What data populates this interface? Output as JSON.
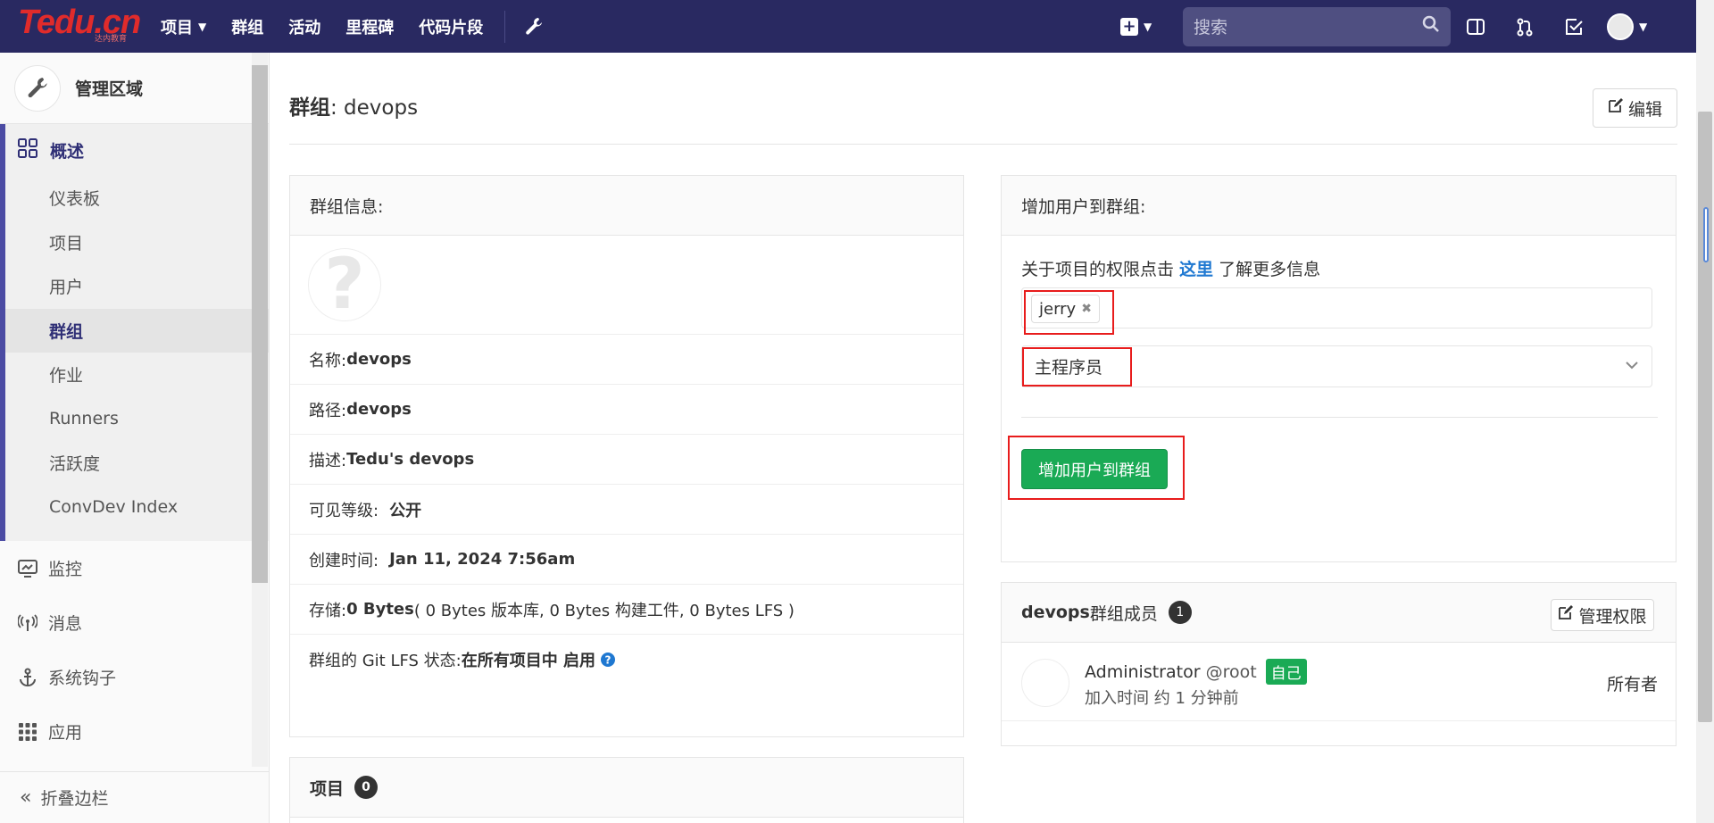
{
  "navbar": {
    "logo_text": "Tedu.cn",
    "logo_sub": "达内教育",
    "links": [
      "项目",
      "群组",
      "活动",
      "里程碑",
      "代码片段"
    ],
    "search_placeholder": "搜索"
  },
  "sidebar": {
    "title": "管理区域",
    "overview_label": "概述",
    "sub_items": [
      "仪表板",
      "项目",
      "用户",
      "群组",
      "作业",
      "Runners",
      "活跃度",
      "ConvDev Index"
    ],
    "active_sub": "群组",
    "items": [
      "监控",
      "消息",
      "系统钩子",
      "应用"
    ],
    "collapse_label": "折叠边栏"
  },
  "page": {
    "title_label": "群组",
    "title_name": ": devops",
    "edit_label": "编辑"
  },
  "group_info": {
    "header": "群组信息:",
    "name_label": "名称: ",
    "name_value": "devops",
    "path_label": "路径: ",
    "path_value": "devops",
    "desc_label": "描述: ",
    "desc_value": "Tedu's devops",
    "visibility_label": "可见等级:",
    "visibility_value": "公开",
    "created_label": "创建时间:",
    "created_value": "Jan 11, 2024 7:56am",
    "storage_label": "存储: ",
    "storage_value": "0 Bytes",
    "storage_detail": " ( 0 Bytes 版本库, 0 Bytes 构建工件, 0 Bytes LFS )",
    "lfs_label": "群组的 Git LFS 状态: ",
    "lfs_value": "在所有项目中 启用"
  },
  "projects_panel": {
    "header": "项目",
    "count": "0"
  },
  "add_user": {
    "header": "增加用户到群组:",
    "hint_prefix": "关于项目的权限点击 ",
    "hint_link": "这里",
    "hint_suffix": " 了解更多信息",
    "token_value": "jerry",
    "role_value": "主程序员",
    "submit_label": "增加用户到群组"
  },
  "members": {
    "group_name": "devops",
    "header_suffix": " 群组成员",
    "count": "1",
    "manage_label": "管理权限",
    "list": [
      {
        "name": "Administrator",
        "username": "@root",
        "badge": "自己",
        "joined": "加入时间 约 1 分钟前",
        "role": "所有者"
      }
    ]
  },
  "colors": {
    "navbar": "#292961",
    "sidebar_accent": "#4b4ba3",
    "success": "#1aaa55",
    "annotation_red": "#e81c1c",
    "link": "#1f78d1"
  }
}
